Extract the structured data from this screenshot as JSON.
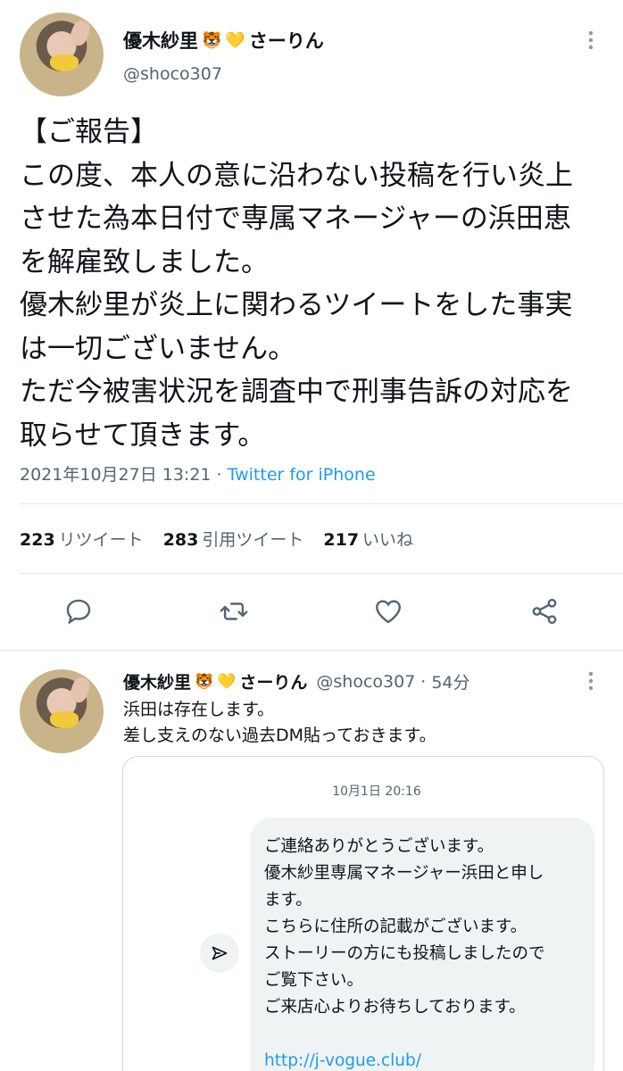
{
  "main_tweet": {
    "display_name": "優木紗里",
    "name_suffix": "さーりん",
    "emoji_tiger": "🐯",
    "emoji_heart": "💛",
    "handle": "@shoco307",
    "text_lines": [
      "【ご報告】",
      "この度、本人の意に沿わない投稿を行い炎上",
      "させた為本日付で専属マネージャーの浜田恵",
      "を解雇致しました。",
      "優木紗里が炎上に関わるツイートをした事実",
      "は一切ございません。",
      "ただ今被害状況を調査中で刑事告訴の対応を",
      "取らせて頂きます。"
    ],
    "timestamp": "2021年10月27日 13:21",
    "separator": " · ",
    "source": "Twitter for iPhone",
    "stats": [
      {
        "count": "223",
        "label": "リツイート"
      },
      {
        "count": "283",
        "label": "引用ツイート"
      },
      {
        "count": "217",
        "label": "いいね"
      }
    ],
    "actions": [
      "reply-icon",
      "retweet-icon",
      "like-icon",
      "share-icon"
    ]
  },
  "reply_tweet": {
    "display_name": "優木紗里",
    "name_suffix": "さーりん",
    "emoji_tiger": "🐯",
    "emoji_heart": "💛",
    "handle": "@shoco307",
    "time": "54分",
    "separator": "·",
    "text_lines": [
      "浜田は存在します。",
      "差し支えのない過去DM貼っておきます。"
    ],
    "dm": {
      "timestamp": "10月1日 20:16",
      "message_lines": [
        "ご連絡ありがとうございます。",
        "優木紗里専属マネージャー浜田と申し",
        "ます。",
        "こちらに住所の記載がございます。",
        "ストーリーの方にも投稿しましたので",
        "ご覧下さい。",
        "ご来店心よりお待ちしております。",
        "",
        "http://j-vogue.club/"
      ]
    }
  },
  "colors": {
    "text": "#0f1419",
    "secondary": "#536471",
    "link": "#1d9bf0",
    "divider": "#e1e8ed",
    "bubble": "#eff3f4"
  }
}
